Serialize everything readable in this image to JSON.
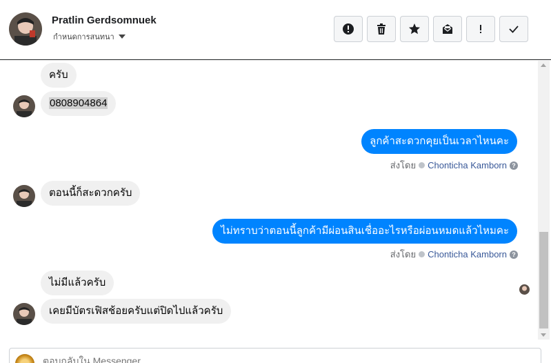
{
  "header": {
    "name": "Pratlin Gerdsomnuek",
    "assign_label": "กำหนดการสนทนา",
    "actions": [
      "spam",
      "delete",
      "star",
      "mark-unread",
      "follow-up",
      "done"
    ]
  },
  "messages": {
    "m1": "ครับ",
    "m2": "0808904864",
    "m3": "ลูกค้าสะดวกคุยเป็นเวลาไหนคะ",
    "m4": "ตอนนี้ก็สะดวกครับ",
    "m5": "ไม่ทราบว่าตอนนี้ลูกค้ามีผ่อนสินเชื่ออะไรหรือผ่อนหมดแล้วไหมคะ",
    "m6": "ไม่มีแล้วครับ",
    "m7": "เคยมีบัตรเฟิสช้อยครับแต่ปิดไปแล้วครับ"
  },
  "sent_by": {
    "prefix": "ส่งโดย",
    "agent": "Chonticha Kamborn",
    "help": "?"
  },
  "composer": {
    "placeholder": "ตอบกลับใน Messenger"
  },
  "colors": {
    "outgoing": "#0084ff",
    "incoming": "#f0f0f0",
    "agent_link": "#385898"
  }
}
